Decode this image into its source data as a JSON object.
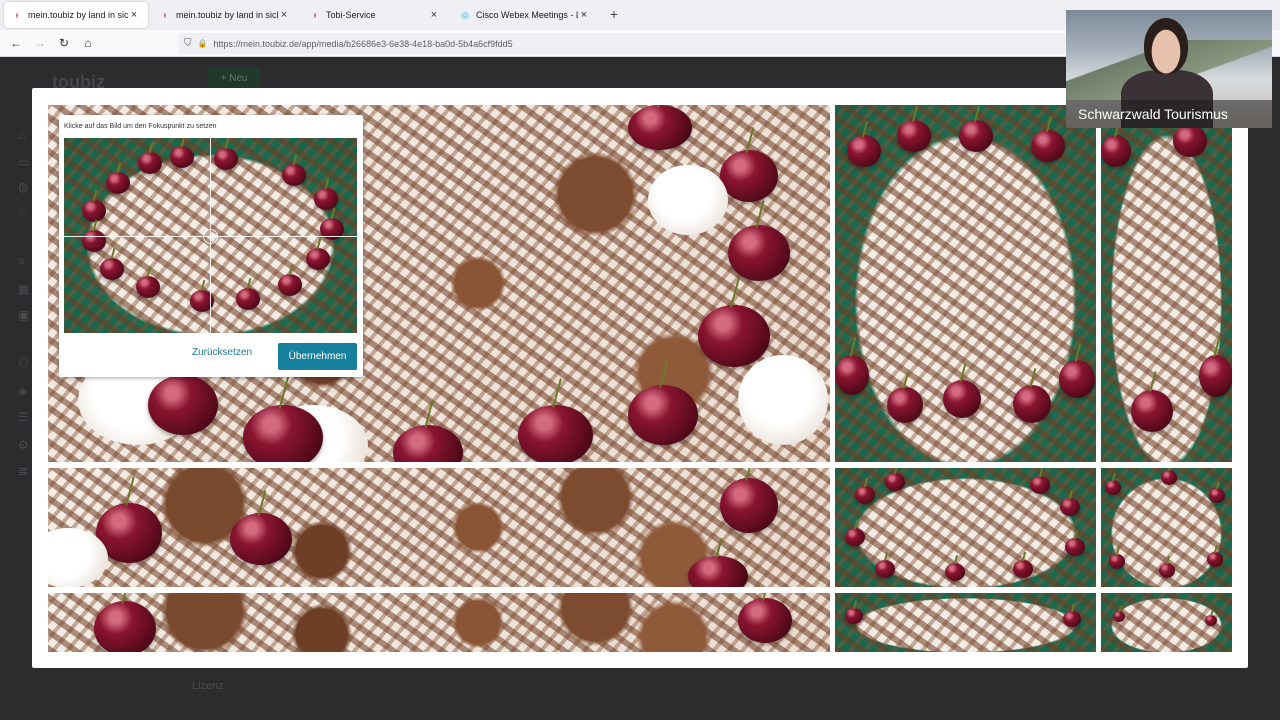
{
  "browser": {
    "tabs": [
      {
        "title": "mein.toubiz by land in sicht",
        "favicon": "ᵻ",
        "favicon_color": "#b0184e",
        "active": true
      },
      {
        "title": "mein.toubiz by land in sicht",
        "favicon": "ᵻ",
        "favicon_color": "#b0184e",
        "active": false
      },
      {
        "title": "Tobi-Service",
        "favicon": "ᵻ",
        "favicon_color": "#b0184e",
        "active": false
      },
      {
        "title": "Cisco Webex Meetings - Landin",
        "favicon": "◎",
        "favicon_color": "#2aa0d8",
        "active": false
      }
    ],
    "new_tab": "+",
    "close_glyph": "×",
    "nav": {
      "back": "←",
      "forward": "→",
      "reload": "↻",
      "home": "⌂"
    },
    "url": "https://mein.toubiz.de/app/media/b26686e3-6e38-4e18-ba0d-5b4a6cf9fdd5",
    "url_icons": {
      "shield": "⛉",
      "lock": "🔒"
    }
  },
  "app": {
    "logo": "toubiz",
    "new_button": "+ Neu",
    "lizenz": "Lizenz"
  },
  "focus_dialog": {
    "hint": "Klicke auf das Bild um den Fokuspunkt zu setzen",
    "reset_label": "Zurücksetzen",
    "apply_label": "Übernehmen"
  },
  "webcam": {
    "name": "Schwarzwald Tourismus"
  },
  "colors": {
    "accent": "#17809c",
    "link": "#1d7a96",
    "cake_board_green": "#1d6b50"
  }
}
